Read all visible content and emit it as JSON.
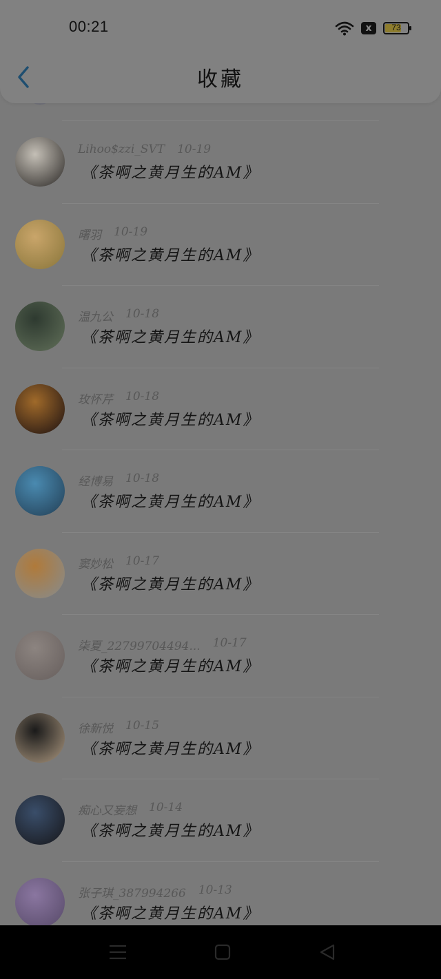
{
  "status_bar": {
    "time": "00:21",
    "battery_level": "73",
    "battery_fraction": 0.73,
    "x_badge": "x"
  },
  "header": {
    "title": "收藏",
    "back_icon": "chevron-left-icon"
  },
  "items": [
    {
      "name": "Lihoo$zzi_SVT",
      "date": "10-19",
      "title": "《茶啊之黄月生的AM》",
      "avatar_colors": [
        "#c4bfb6",
        "#3b3835"
      ]
    },
    {
      "name": "曙羽",
      "date": "10-19",
      "title": "《茶啊之黄月生的AM》",
      "avatar_colors": [
        "#c9a56a",
        "#8f7a3f"
      ]
    },
    {
      "name": "温九公",
      "date": "10-18",
      "title": "《茶啊之黄月生的AM》",
      "avatar_colors": [
        "#2e3a30",
        "#5c6a55"
      ]
    },
    {
      "name": "玫怀芹",
      "date": "10-18",
      "title": "《茶啊之黄月生的AM》",
      "avatar_colors": [
        "#a06a2a",
        "#2a1a14"
      ]
    },
    {
      "name": "经博易",
      "date": "10-18",
      "title": "《茶啊之黄月生的AM》",
      "avatar_colors": [
        "#4a8ab0",
        "#26465e"
      ]
    },
    {
      "name": "窦妙松",
      "date": "10-17",
      "title": "《茶啊之黄月生的AM》",
      "avatar_colors": [
        "#b07a3a",
        "#8a8a86"
      ]
    },
    {
      "name": "柒夏_22799704494...",
      "date": "10-17",
      "title": "《茶啊之黄月生的AM》",
      "avatar_colors": [
        "#8c8480",
        "#6a6260"
      ]
    },
    {
      "name": "徐新悦",
      "date": "10-15",
      "title": "《茶啊之黄月生的AM》",
      "avatar_colors": [
        "#1a1a1a",
        "#9c8a74"
      ]
    },
    {
      "name": "痴心又妄想",
      "date": "10-14",
      "title": "《茶啊之黄月生的AM》",
      "avatar_colors": [
        "#3a4e6a",
        "#1a1c22"
      ]
    },
    {
      "name": "张子琪_387994266",
      "date": "10-13",
      "title": "《茶啊之黄月生的AM》",
      "avatar_colors": [
        "#8a76a0",
        "#5c4e6e"
      ]
    }
  ],
  "nav": {
    "menu_icon": "menu-icon",
    "home_icon": "home-square-icon",
    "back_icon": "back-triangle-icon"
  }
}
